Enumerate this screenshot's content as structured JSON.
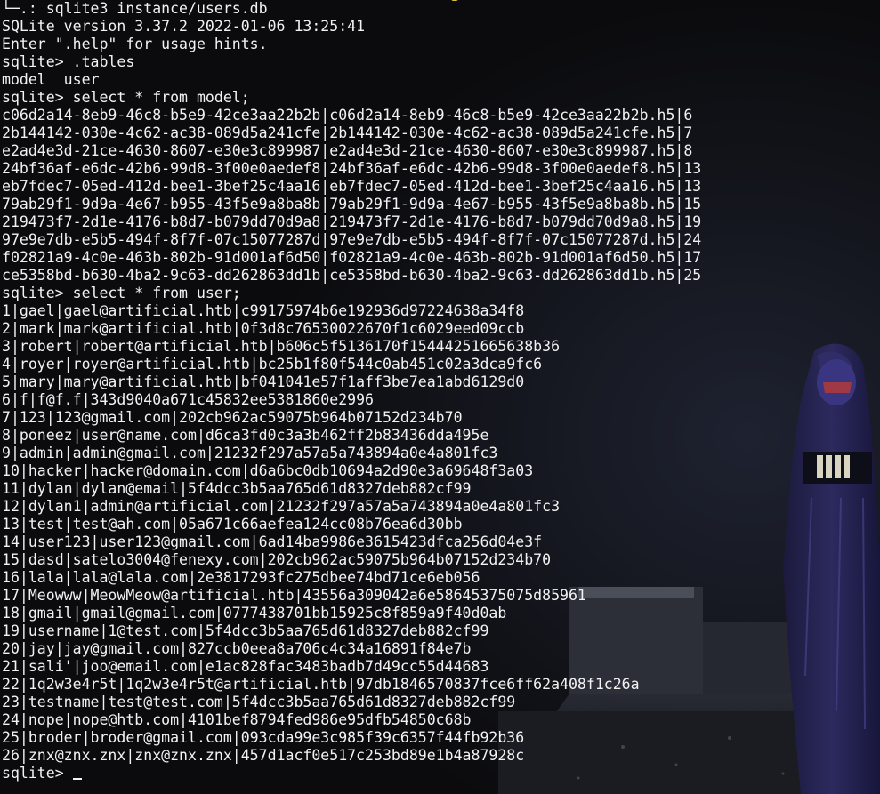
{
  "terminal": {
    "background_color": "#0b0b0d",
    "text_color": "#f2f2f2",
    "lines": [
      "└─.: sqlite3 instance/users.db",
      "SQLite version 3.37.2 2022-01-06 13:25:41",
      "Enter \".help\" for usage hints.",
      "sqlite> .tables",
      "model  user",
      "sqlite> select * from model;",
      "c06d2a14-8eb9-46c8-b5e9-42ce3aa22b2b|c06d2a14-8eb9-46c8-b5e9-42ce3aa22b2b.h5|6",
      "2b144142-030e-4c62-ac38-089d5a241cfe|2b144142-030e-4c62-ac38-089d5a241cfe.h5|7",
      "e2ad4e3d-21ce-4630-8607-e30e3c899987|e2ad4e3d-21ce-4630-8607-e30e3c899987.h5|8",
      "24bf36af-e6dc-42b6-99d8-3f00e0aedef8|24bf36af-e6dc-42b6-99d8-3f00e0aedef8.h5|13",
      "eb7fdec7-05ed-412d-bee1-3bef25c4aa16|eb7fdec7-05ed-412d-bee1-3bef25c4aa16.h5|13",
      "79ab29f1-9d9a-4e67-b955-43f5e9a8ba8b|79ab29f1-9d9a-4e67-b955-43f5e9a8ba8b.h5|15",
      "219473f7-2d1e-4176-b8d7-b079dd70d9a8|219473f7-2d1e-4176-b8d7-b079dd70d9a8.h5|19",
      "97e9e7db-e5b5-494f-8f7f-07c15077287d|97e9e7db-e5b5-494f-8f7f-07c15077287d.h5|24",
      "f02821a9-4c0e-463b-802b-91d001af6d50|f02821a9-4c0e-463b-802b-91d001af6d50.h5|17",
      "ce5358bd-b630-4ba2-9c63-dd262863dd1b|ce5358bd-b630-4ba2-9c63-dd262863dd1b.h5|25",
      "sqlite> select * from user;",
      "1|gael|gael@artificial.htb|c99175974b6e192936d97224638a34f8",
      "2|mark|mark@artificial.htb|0f3d8c76530022670f1c6029eed09ccb",
      "3|robert|robert@artificial.htb|b606c5f5136170f15444251665638b36",
      "4|royer|royer@artificial.htb|bc25b1f80f544c0ab451c02a3dca9fc6",
      "5|mary|mary@artificial.htb|bf041041e57f1aff3be7ea1abd6129d0",
      "6|f|f@f.f|343d9040a671c45832ee5381860e2996",
      "7|123|123@gmail.com|202cb962ac59075b964b07152d234b70",
      "8|poneez|user@name.com|d6ca3fd0c3a3b462ff2b83436dda495e",
      "9|admin|admin@gmail.com|21232f297a57a5a743894a0e4a801fc3",
      "10|hacker|hacker@domain.com|d6a6bc0db10694a2d90e3a69648f3a03",
      "11|dylan|dylan@email|5f4dcc3b5aa765d61d8327deb882cf99",
      "12|dylan1|admin@artificial.com|21232f297a57a5a743894a0e4a801fc3",
      "13|test|test@ah.com|05a671c66aefea124cc08b76ea6d30bb",
      "14|user123|user123@gmail.com|6ad14ba9986e3615423dfca256d04e3f",
      "15|dasd|satelo3004@fenexy.com|202cb962ac59075b964b07152d234b70",
      "16|lala|lala@lala.com|2e3817293fc275dbee74bd71ce6eb056",
      "17|Meowww|MeowMeow@artificial.htb|43556a309042a6e58645375075d85961",
      "18|gmail|gmail@gmail.com|0777438701bb15925c8f859a9f40d0ab",
      "19|username|1@test.com|5f4dcc3b5aa765d61d8327deb882cf99",
      "20|jay|jay@gmail.com|827ccb0eea8a706c4c34a16891f84e7b",
      "21|sali'|joo@email.com|e1ac828fac3483badb7d49cc55d44683",
      "22|1q2w3e4r5t|1q2w3e4r5t@artificial.htb|97db1846570837fce6ff62a408f1c26a",
      "23|testname|test@test.com|5f4dcc3b5aa765d61d8327deb882cf99",
      "24|nope|nope@htb.com|4101bef8794fed986e95dfb54850c68b",
      "25|broder|broder@gmail.com|093cda99e3c985f39c6357f44fb92b36",
      "26|znx@znx.znx|znx@znx.znx|457d1acf0e517c253bd89e1b4a87928c"
    ],
    "prompt": "sqlite> "
  }
}
